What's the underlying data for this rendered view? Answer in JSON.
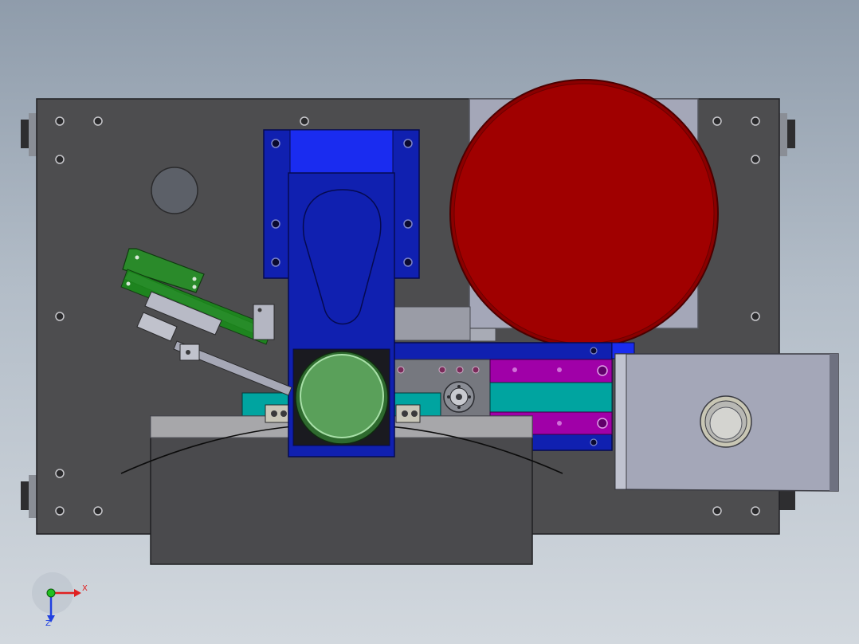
{
  "triad": {
    "x_label": "X",
    "z_label": "Z"
  },
  "colors": {
    "plate": "#4d4d4f",
    "bracket_blue": "#1020b0",
    "bright_blue": "#1a2cf0",
    "turntable_red": "#9c0000",
    "knob_green": "#5aa05a",
    "pcb_green": "#1a8a1a",
    "slide_magenta": "#a000a8",
    "slide_teal": "#00a4a0",
    "housing_grey": "#a4a7b8",
    "triad_x": "#e02020",
    "triad_y": "#20c020",
    "triad_z": "#2040e0"
  }
}
